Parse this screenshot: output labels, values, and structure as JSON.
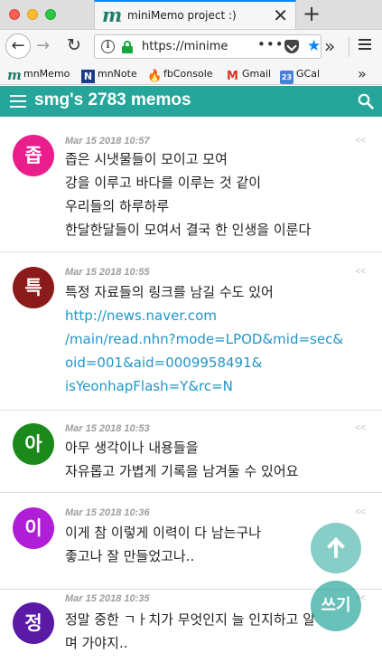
{
  "browser": {
    "tab_title": "miniMemo project :)",
    "url": "https://minime",
    "bookmarks": [
      {
        "label": "mnMemo",
        "icon": "m"
      },
      {
        "label": "mnNote",
        "icon": "N"
      },
      {
        "label": "fbConsole",
        "icon": "fb"
      },
      {
        "label": "Gmail",
        "icon": "M"
      },
      {
        "label": "GCal",
        "icon": "23"
      }
    ]
  },
  "app": {
    "title": "smg's 2783 memos",
    "accent": "#26a69a"
  },
  "memos": [
    {
      "avatar": "좁",
      "avatar_color": "#e91e8c",
      "date": "Mar 15 2018 10:57",
      "lines": [
        "좁은 시냇물들이 모이고 모여",
        "강을 이루고 바다를 이루는 것 같이",
        "우리들의 하루하루",
        "한달한달들이 모여서 결국 한 인생을 이룬다"
      ],
      "links": []
    },
    {
      "avatar": "특",
      "avatar_color": "#8b1a1a",
      "date": "Mar 15 2018 10:55",
      "lines": [
        "특정 자료들의 링크를 남길 수도 있어"
      ],
      "links": [
        "http://news.naver.com",
        "/main/read.nhn?mode=LPOD&mid=sec&",
        "oid=001&aid=0009958491&",
        "isYeonhapFlash=Y&rc=N"
      ]
    },
    {
      "avatar": "아",
      "avatar_color": "#1b8a1b",
      "date": "Mar 15 2018 10:53",
      "lines": [
        "아무 생각이나 내용들을",
        "자유롭고 가볍게 기록을 남겨둘 수 있어요"
      ],
      "links": []
    },
    {
      "avatar": "이",
      "avatar_color": "#b01ed8",
      "date": "Mar 15 2018 10:36",
      "lines": [
        "이게 참 이렇게 이력이 다 남는구나",
        "좋고나 잘 만들었고나.."
      ],
      "links": []
    },
    {
      "avatar": "정",
      "avatar_color": "#5a1aa6",
      "date": "Mar 15 2018 10:35",
      "lines": [
        "정말 중한 ㄱㅏ치가 무엇인지 늘 인지하고 알",
        "며 가야지.."
      ],
      "links": []
    }
  ],
  "chevron": "<<",
  "fab_write_label": "쓰기"
}
